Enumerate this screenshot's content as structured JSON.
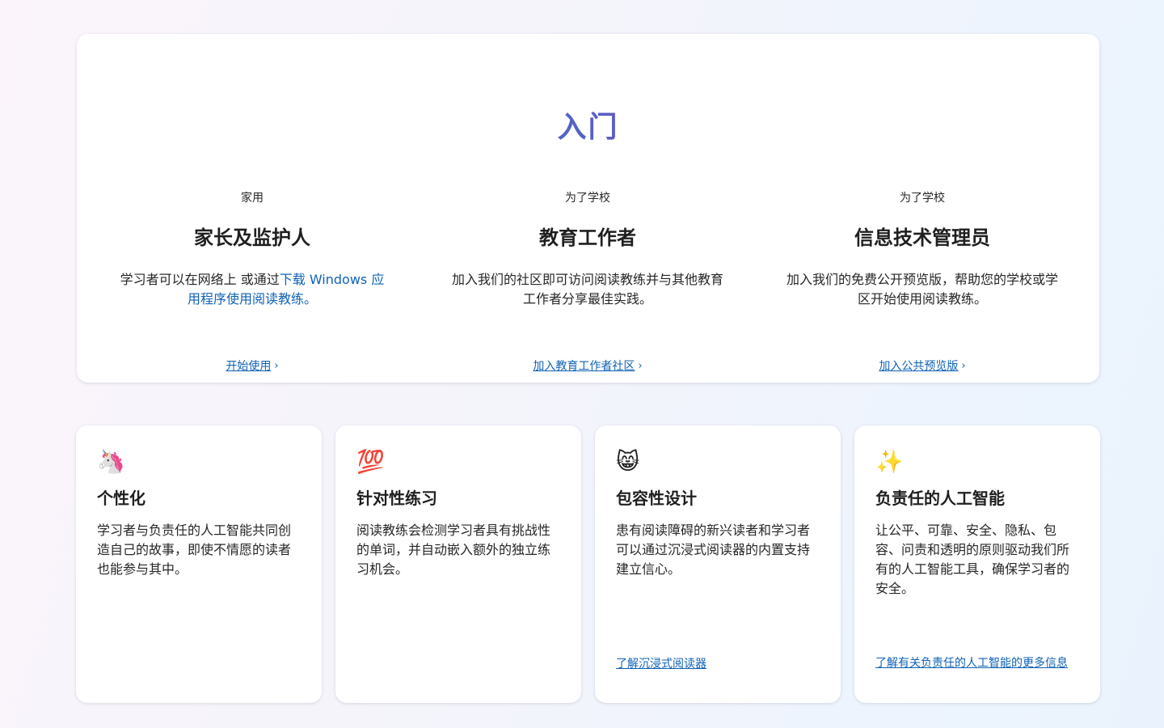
{
  "getting_started": {
    "title": "入门",
    "columns": [
      {
        "eyebrow": "家用",
        "heading": "家长及监护人",
        "desc_prefix": "学习者可以在网络上 或通过",
        "desc_link": "下载 Windows 应用程序使用阅读教练。",
        "cta": "开始使用"
      },
      {
        "eyebrow": "为了学校",
        "heading": "教育工作者",
        "desc": "加入我们的社区即可访问阅读教练并与其他教育工作者分享最佳实践。",
        "cta": "加入教育工作者社区"
      },
      {
        "eyebrow": "为了学校",
        "heading": "信息技术管理员",
        "desc": "加入我们的免费公开预览版，帮助您的学校或学区开始使用阅读教练。",
        "cta": "加入公共预览版"
      }
    ]
  },
  "features": [
    {
      "icon": "unicorn-icon",
      "emoji": "🦄",
      "title": "个性化",
      "desc": "学习者与负责任的人工智能共同创造自己的故事，即使不情愿的读者也能参与其中。",
      "link": ""
    },
    {
      "icon": "hundred-points-icon",
      "emoji": "💯",
      "title": "针对性练习",
      "desc": "阅读教练会检测学习者具有挑战性的单词，并自动嵌入额外的独立练习机会。",
      "link": ""
    },
    {
      "icon": "grinning-cat-icon",
      "emoji": "😸",
      "title": "包容性设计",
      "desc": "患有阅读障碍的新兴读者和学习者可以通过沉浸式阅读器的内置支持建立信心。",
      "link": "了解沉浸式阅读器"
    },
    {
      "icon": "sparkles-icon",
      "emoji": "✨",
      "title": "负责任的人工智能",
      "desc": "让公平、可靠、安全、隐私、包容、问责和透明的原则驱动我们所有的人工智能工具，确保学习者的安全。",
      "link": "了解有关负责任的人工智能的更多信息"
    }
  ],
  "colors": {
    "link": "#0f62b5",
    "title_gradient_start": "#2c82c9",
    "title_gradient_end": "#8a3fbd",
    "card_bg": "#ffffff"
  }
}
